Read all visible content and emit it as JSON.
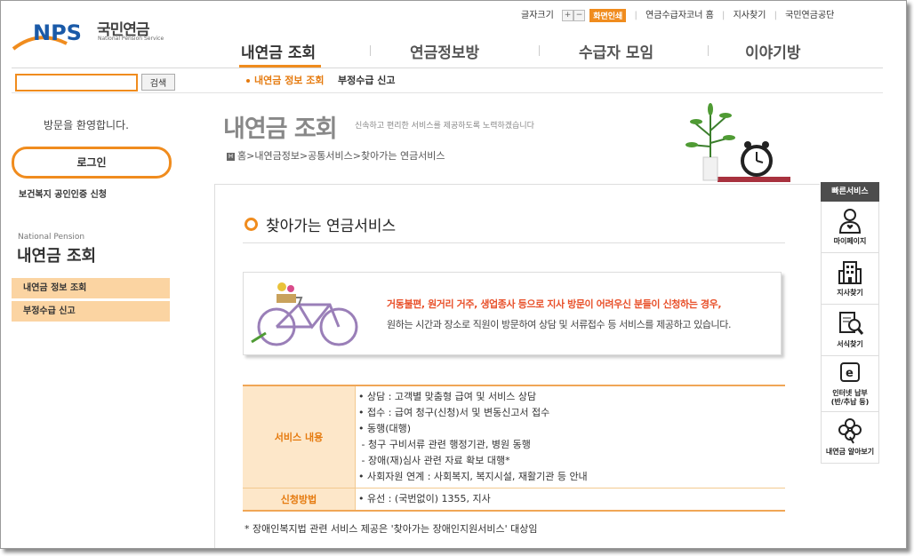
{
  "header": {
    "logo_text": "NPS",
    "logo_kr": "국민연금",
    "logo_en": "National Pension Service",
    "util": {
      "font_size_label": "글자크기",
      "zoom_in": "+",
      "zoom_out": "−",
      "screen_print": "화면인쇄",
      "links": [
        "연금수급자코너 홈",
        "지사찾기",
        "국민연금공단"
      ]
    }
  },
  "gnb": [
    "내연금 조회",
    "연금정보방",
    "수급자 모임",
    "이야기방"
  ],
  "search": {
    "button_label": "검색",
    "value": ""
  },
  "subnav": [
    "내연금 정보 조회",
    "부정수급 신고"
  ],
  "sidebar": {
    "welcome": "방문을 환영합니다.",
    "login_label": "로그인",
    "cert_link": "보건복지 공인인증 신청",
    "section_en": "National Pension",
    "section_title": "내연금 조회",
    "items": [
      "내연금 정보 조회",
      "부정수급 신고"
    ]
  },
  "page": {
    "title": "내연금 조회",
    "desc": "신속하고 편리한 서비스를 제공하도록 노력하겠습니다",
    "breadcrumb": "홈>내연금정보>공통서비스>찾아가는 연금서비스"
  },
  "content": {
    "section_title": "찾아가는 연금서비스",
    "banner_line1": "거동불편, 원거리 거주, 생업종사 등으로 지사 방문이 어려우신 분들이 신청하는 경우,",
    "banner_line2": "원하는 시간과 장소로 직원이 방문하여 상담 및 서류접수 등 서비스를 제공하고 있습니다.",
    "table": {
      "row1_header": "서비스 내용",
      "row1_lines": [
        "• 상담 : 고객별 맞춤형 급여 및 서비스 상담",
        "• 접수 : 급여 청구(신청)서 및 변동신고서 접수",
        "• 동행(대행)",
        " - 청구 구비서류 관련 행정기관, 병원 동행",
        " - 장애(재)심사 관련 자료 확보 대행*",
        "• 사회자원 연계 : 사회복지, 복지시설, 재활기관 등 안내"
      ],
      "row2_header": "신청방법",
      "row2_value": "• 유선 : (국번없이) 1355, 지사"
    },
    "footnote": "* 장애인복지법 관련 서비스 제공은 '찾아가는 장애인지원서비스' 대상임"
  },
  "quick_menu": {
    "title": "빠른서비스",
    "items": [
      "마이페이지",
      "지사찾기",
      "서식찾기",
      "인터넷 납부\n(반/추납 등)",
      "내연금 알아보기"
    ]
  },
  "colors": {
    "accent": "#f08c1e",
    "table_header_bg": "#fde7c9",
    "banner_highlight": "#e8502a"
  }
}
